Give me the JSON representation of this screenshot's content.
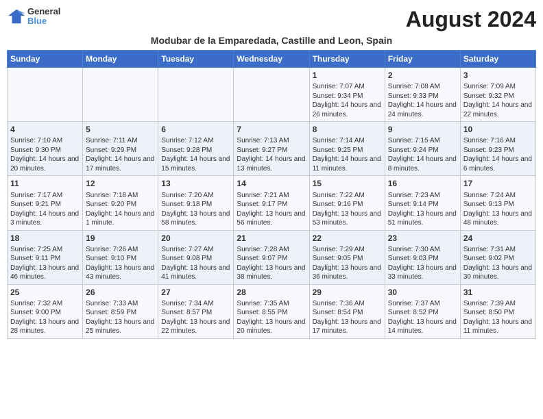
{
  "header": {
    "logo_line1": "General",
    "logo_line2": "Blue",
    "month_title": "August 2024",
    "location": "Modubar de la Emparedada, Castille and Leon, Spain"
  },
  "weekdays": [
    "Sunday",
    "Monday",
    "Tuesday",
    "Wednesday",
    "Thursday",
    "Friday",
    "Saturday"
  ],
  "weeks": [
    [
      {
        "day": "",
        "info": ""
      },
      {
        "day": "",
        "info": ""
      },
      {
        "day": "",
        "info": ""
      },
      {
        "day": "",
        "info": ""
      },
      {
        "day": "1",
        "info": "Sunrise: 7:07 AM\nSunset: 9:34 PM\nDaylight: 14 hours and 26 minutes."
      },
      {
        "day": "2",
        "info": "Sunrise: 7:08 AM\nSunset: 9:33 PM\nDaylight: 14 hours and 24 minutes."
      },
      {
        "day": "3",
        "info": "Sunrise: 7:09 AM\nSunset: 9:32 PM\nDaylight: 14 hours and 22 minutes."
      }
    ],
    [
      {
        "day": "4",
        "info": "Sunrise: 7:10 AM\nSunset: 9:30 PM\nDaylight: 14 hours and 20 minutes."
      },
      {
        "day": "5",
        "info": "Sunrise: 7:11 AM\nSunset: 9:29 PM\nDaylight: 14 hours and 17 minutes."
      },
      {
        "day": "6",
        "info": "Sunrise: 7:12 AM\nSunset: 9:28 PM\nDaylight: 14 hours and 15 minutes."
      },
      {
        "day": "7",
        "info": "Sunrise: 7:13 AM\nSunset: 9:27 PM\nDaylight: 14 hours and 13 minutes."
      },
      {
        "day": "8",
        "info": "Sunrise: 7:14 AM\nSunset: 9:25 PM\nDaylight: 14 hours and 11 minutes."
      },
      {
        "day": "9",
        "info": "Sunrise: 7:15 AM\nSunset: 9:24 PM\nDaylight: 14 hours and 8 minutes."
      },
      {
        "day": "10",
        "info": "Sunrise: 7:16 AM\nSunset: 9:23 PM\nDaylight: 14 hours and 6 minutes."
      }
    ],
    [
      {
        "day": "11",
        "info": "Sunrise: 7:17 AM\nSunset: 9:21 PM\nDaylight: 14 hours and 3 minutes."
      },
      {
        "day": "12",
        "info": "Sunrise: 7:18 AM\nSunset: 9:20 PM\nDaylight: 14 hours and 1 minute."
      },
      {
        "day": "13",
        "info": "Sunrise: 7:20 AM\nSunset: 9:18 PM\nDaylight: 13 hours and 58 minutes."
      },
      {
        "day": "14",
        "info": "Sunrise: 7:21 AM\nSunset: 9:17 PM\nDaylight: 13 hours and 56 minutes."
      },
      {
        "day": "15",
        "info": "Sunrise: 7:22 AM\nSunset: 9:16 PM\nDaylight: 13 hours and 53 minutes."
      },
      {
        "day": "16",
        "info": "Sunrise: 7:23 AM\nSunset: 9:14 PM\nDaylight: 13 hours and 51 minutes."
      },
      {
        "day": "17",
        "info": "Sunrise: 7:24 AM\nSunset: 9:13 PM\nDaylight: 13 hours and 48 minutes."
      }
    ],
    [
      {
        "day": "18",
        "info": "Sunrise: 7:25 AM\nSunset: 9:11 PM\nDaylight: 13 hours and 46 minutes."
      },
      {
        "day": "19",
        "info": "Sunrise: 7:26 AM\nSunset: 9:10 PM\nDaylight: 13 hours and 43 minutes."
      },
      {
        "day": "20",
        "info": "Sunrise: 7:27 AM\nSunset: 9:08 PM\nDaylight: 13 hours and 41 minutes."
      },
      {
        "day": "21",
        "info": "Sunrise: 7:28 AM\nSunset: 9:07 PM\nDaylight: 13 hours and 38 minutes."
      },
      {
        "day": "22",
        "info": "Sunrise: 7:29 AM\nSunset: 9:05 PM\nDaylight: 13 hours and 36 minutes."
      },
      {
        "day": "23",
        "info": "Sunrise: 7:30 AM\nSunset: 9:03 PM\nDaylight: 13 hours and 33 minutes."
      },
      {
        "day": "24",
        "info": "Sunrise: 7:31 AM\nSunset: 9:02 PM\nDaylight: 13 hours and 30 minutes."
      }
    ],
    [
      {
        "day": "25",
        "info": "Sunrise: 7:32 AM\nSunset: 9:00 PM\nDaylight: 13 hours and 28 minutes."
      },
      {
        "day": "26",
        "info": "Sunrise: 7:33 AM\nSunset: 8:59 PM\nDaylight: 13 hours and 25 minutes."
      },
      {
        "day": "27",
        "info": "Sunrise: 7:34 AM\nSunset: 8:57 PM\nDaylight: 13 hours and 22 minutes."
      },
      {
        "day": "28",
        "info": "Sunrise: 7:35 AM\nSunset: 8:55 PM\nDaylight: 13 hours and 20 minutes."
      },
      {
        "day": "29",
        "info": "Sunrise: 7:36 AM\nSunset: 8:54 PM\nDaylight: 13 hours and 17 minutes."
      },
      {
        "day": "30",
        "info": "Sunrise: 7:37 AM\nSunset: 8:52 PM\nDaylight: 13 hours and 14 minutes."
      },
      {
        "day": "31",
        "info": "Sunrise: 7:39 AM\nSunset: 8:50 PM\nDaylight: 13 hours and 11 minutes."
      }
    ]
  ]
}
